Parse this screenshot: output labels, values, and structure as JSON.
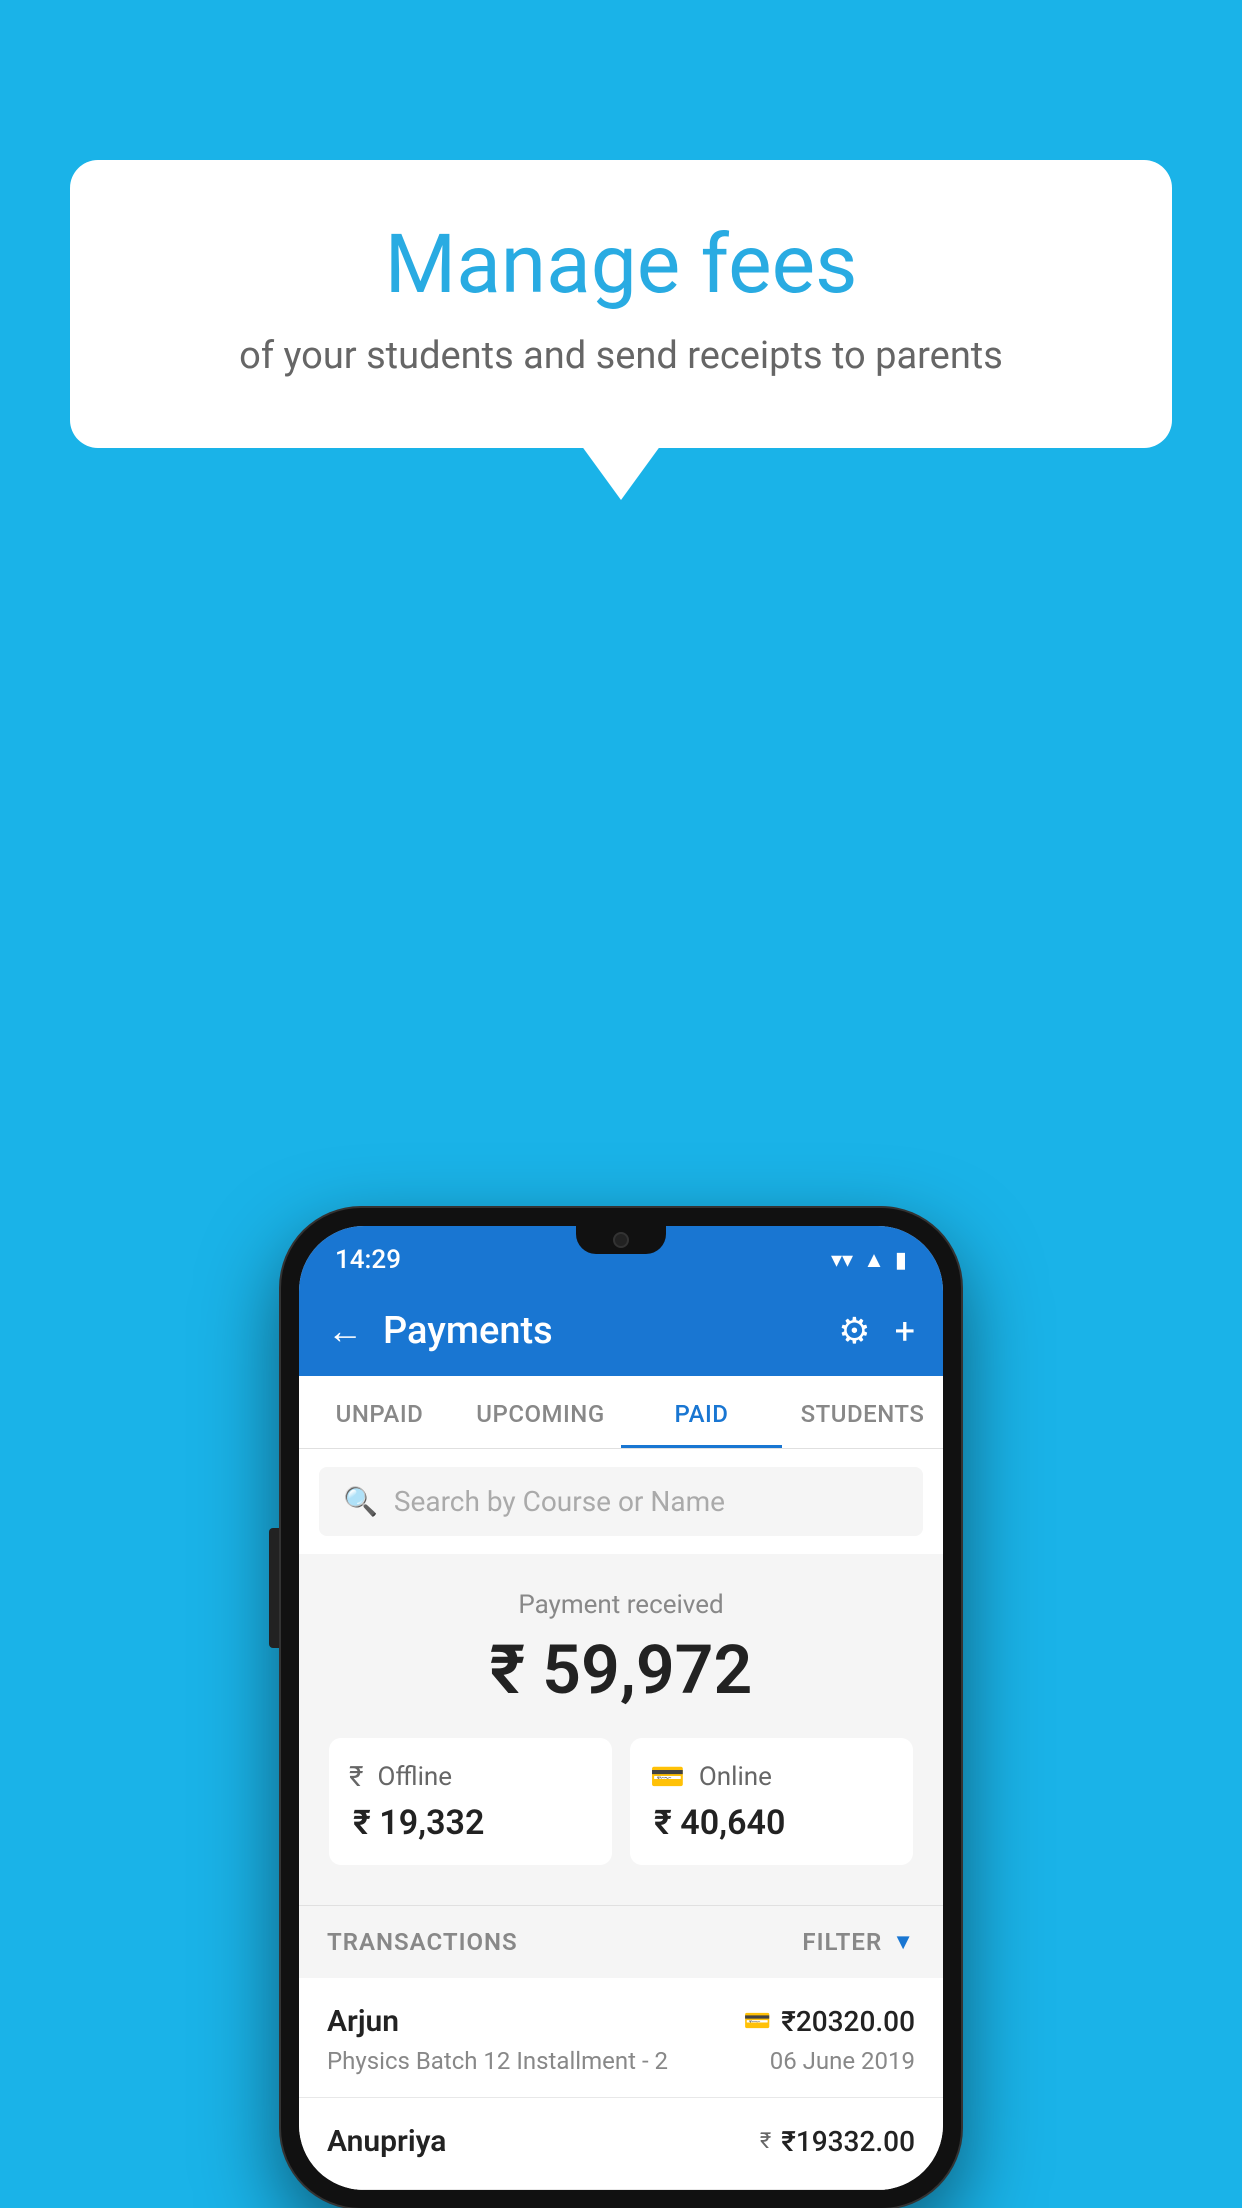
{
  "background_color": "#1ab3e8",
  "speech_bubble": {
    "title": "Manage fees",
    "subtitle": "of your students and send receipts to parents"
  },
  "phone": {
    "status_bar": {
      "time": "14:29",
      "icons": [
        "wifi",
        "signal",
        "battery"
      ]
    },
    "header": {
      "title": "Payments",
      "back_label": "←",
      "gear_label": "⚙",
      "plus_label": "+"
    },
    "tabs": [
      {
        "label": "UNPAID",
        "active": false
      },
      {
        "label": "UPCOMING",
        "active": false
      },
      {
        "label": "PAID",
        "active": true
      },
      {
        "label": "STUDENTS",
        "active": false
      }
    ],
    "search": {
      "placeholder": "Search by Course or Name"
    },
    "payment_summary": {
      "label": "Payment received",
      "amount": "₹ 59,972",
      "offline_label": "Offline",
      "offline_amount": "₹ 19,332",
      "online_label": "Online",
      "online_amount": "₹ 40,640"
    },
    "transactions_section": {
      "label": "TRANSACTIONS",
      "filter_label": "FILTER"
    },
    "transactions": [
      {
        "name": "Arjun",
        "payment_type": "card",
        "amount": "₹20320.00",
        "course": "Physics Batch 12 Installment - 2",
        "date": "06 June 2019"
      },
      {
        "name": "Anupriya",
        "payment_type": "cash",
        "amount": "₹19332.00",
        "course": "",
        "date": ""
      }
    ]
  }
}
